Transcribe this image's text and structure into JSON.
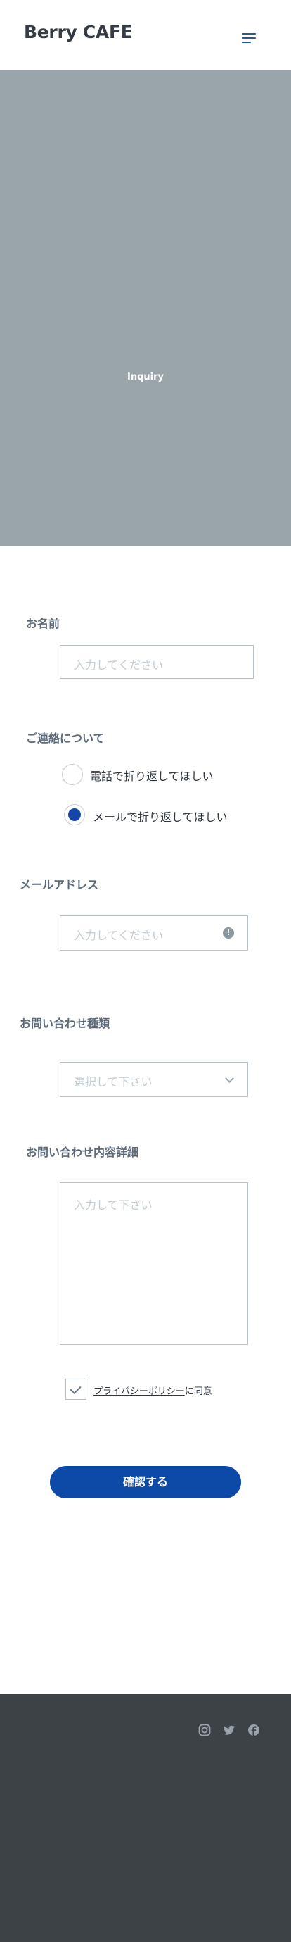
{
  "header": {
    "brand": "Berry CAFE",
    "menu_icon": "hamburger-menu-icon"
  },
  "hero": {
    "label": "Inquiry"
  },
  "form": {
    "name": {
      "label": "お名前",
      "placeholder": "入力してください"
    },
    "contact": {
      "label": "ご連絡について",
      "options": [
        {
          "label": "電話で折り返してほしい",
          "selected": false
        },
        {
          "label": "メールで折り返してほしい",
          "selected": true
        }
      ]
    },
    "email": {
      "label": "メールアドレス",
      "placeholder": "入力してください",
      "icon": "alert-icon"
    },
    "type": {
      "label": "お問い合わせ種類",
      "selected": "選択して下さい",
      "icon": "chevron-down-icon"
    },
    "detail": {
      "label": "お問い合わせ内容詳細",
      "placeholder": "入力して下さい"
    },
    "privacy": {
      "link": "プライバシーポリシー",
      "suffix": "に同意",
      "checked": true
    },
    "submit": "確認する"
  },
  "footer": {
    "social": [
      "instagram-icon",
      "twitter-icon",
      "facebook-icon"
    ],
    "icon_color": "#9ba3aa"
  },
  "colors": {
    "accent": "#0d4aa8",
    "hero": "#9aa4ab",
    "footer": "#3d4247"
  }
}
